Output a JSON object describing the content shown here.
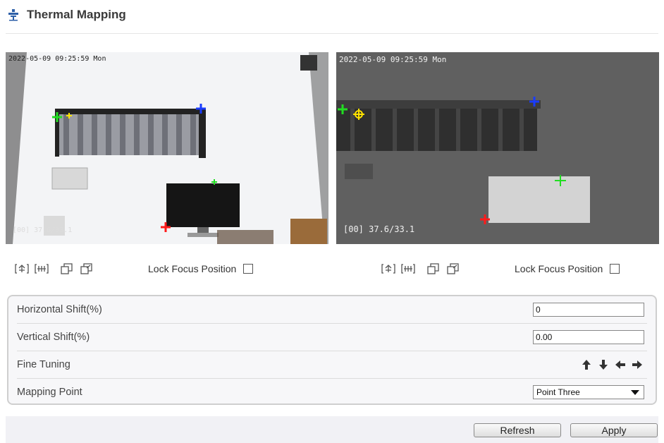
{
  "header": {
    "title": "Thermal Mapping",
    "icon": "thermal-icon"
  },
  "left_video": {
    "timestamp": "2022-05-09 09:25:59 Mon",
    "temp_overlay": "[00] 37.6/33.1"
  },
  "right_video": {
    "timestamp": "2022-05-09 09:25:59 Mon",
    "temp_overlay": "[00] 37.6/33.1"
  },
  "controls": {
    "lock_label": "Lock Focus Position",
    "tools": [
      "zoom-in-icon",
      "zoom-out-icon",
      "restore-icon",
      "fit-icon"
    ]
  },
  "settings": {
    "horizontal": {
      "label": "Horizontal Shift(%)",
      "value": "0"
    },
    "vertical": {
      "label": "Vertical Shift(%)",
      "value": "0.00"
    },
    "fine": {
      "label": "Fine Tuning",
      "arrows": [
        "arrow-up-icon",
        "arrow-down-icon",
        "arrow-left-icon",
        "arrow-right-icon"
      ]
    },
    "mapping": {
      "label": "Mapping Point",
      "selected": "Point Three"
    }
  },
  "footer": {
    "refresh_label": "Refresh",
    "apply_label": "Apply"
  },
  "colors": {
    "green_marker": "#22dd22",
    "blue_marker": "#1a3cff",
    "red_marker": "#ff1a1a",
    "yellow_marker": "#ffe300"
  }
}
